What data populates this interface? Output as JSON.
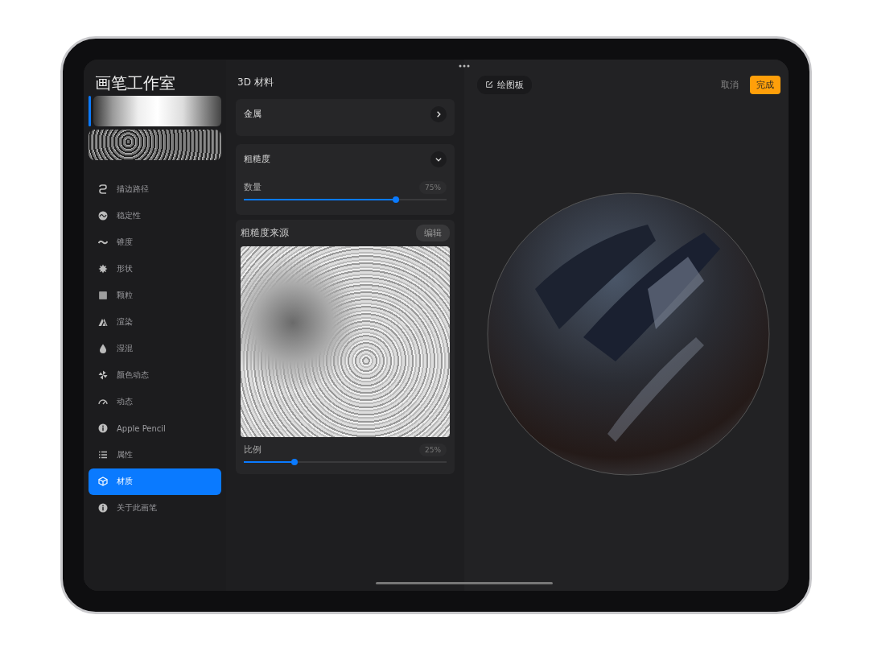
{
  "sidebar": {
    "title": "画笔工作室",
    "items": [
      {
        "label": "描边路径",
        "selected": false
      },
      {
        "label": "稳定性",
        "selected": false
      },
      {
        "label": "锥度",
        "selected": false
      },
      {
        "label": "形状",
        "selected": false
      },
      {
        "label": "颗粒",
        "selected": false
      },
      {
        "label": "渲染",
        "selected": false
      },
      {
        "label": "湿混",
        "selected": false
      },
      {
        "label": "颜色动态",
        "selected": false
      },
      {
        "label": "动态",
        "selected": false
      },
      {
        "label": "Apple Pencil",
        "selected": false
      },
      {
        "label": "属性",
        "selected": false
      },
      {
        "label": "材质",
        "selected": true
      },
      {
        "label": "关于此画笔",
        "selected": false
      }
    ]
  },
  "panel": {
    "title": "3D 材料",
    "sections": [
      {
        "label": "金属",
        "expanded": false
      },
      {
        "label": "粗糙度",
        "expanded": true
      }
    ],
    "amount": {
      "label": "数量",
      "reading": "75%",
      "level": 0.75
    },
    "source": {
      "label": "粗糙度来源",
      "button": "编辑"
    },
    "scale": {
      "label": "比例",
      "reading": "25%",
      "level": 0.25
    }
  },
  "preview": {
    "canvas_button": "绘图板",
    "cancel": "取消",
    "done": "完成"
  }
}
